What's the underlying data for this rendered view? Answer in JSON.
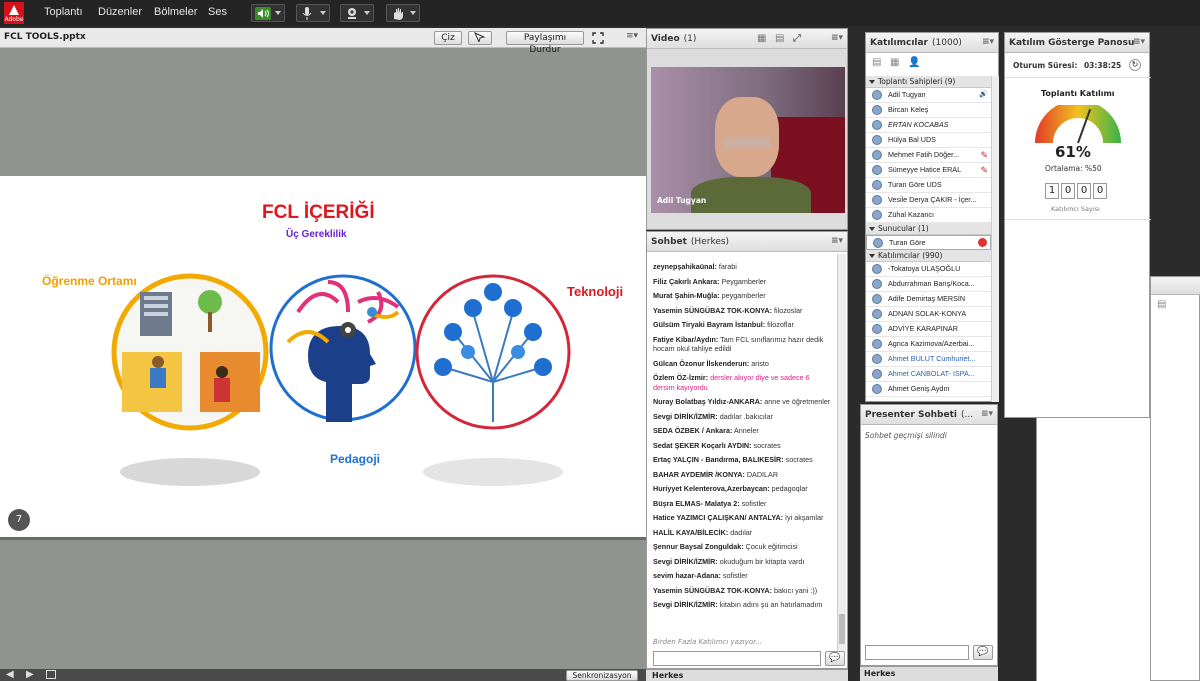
{
  "menubar": {
    "logo_text": "Adobe",
    "items": [
      "Toplantı",
      "Düzenler",
      "Bölmeler",
      "Ses"
    ]
  },
  "share": {
    "title": "FCL TOOLS.pptx",
    "draw_label": "Çiz",
    "stop_label": "Paylaşımı Durdur",
    "sync_label": "Senkronizasyon",
    "page_number": "7"
  },
  "slide": {
    "title": "FCL İÇERİĞİ",
    "subtitle": "Üç Gereklilik",
    "label_left": "Öğrenme Ortamı",
    "label_mid": "Pedagoji",
    "label_right": "Teknoloji"
  },
  "video": {
    "title": "Video",
    "count": "(1)",
    "person_name": "Adil Tugyan"
  },
  "chat": {
    "title": "Sohbet",
    "scope": "(Herkes)",
    "typing": "Birden Fazla Katılımcı yazıyor...",
    "footer": "Herkes",
    "messages": [
      {
        "name": "zeynepşahikaünal:",
        "text": " farabi"
      },
      {
        "name": "Filiz Çakırlı Ankara:",
        "text": " Peygamberler"
      },
      {
        "name": "Murat Şahin-Muğla:",
        "text": " peygamberler"
      },
      {
        "name": "Yasemin SÜNGÜBAZ TOK-KONYA:",
        "text": " filozoslar"
      },
      {
        "name": "Gülsüm Tiryaki Bayram İstanbul:",
        "text": " filozoflar"
      },
      {
        "name": "Fatiye Kibar/Aydın:",
        "text": " Tam FCL sınıflarımız hazır dedik hocam okul tahliye edildi"
      },
      {
        "name": "Gülcan Özonur İlskenderun:",
        "text": " aristo"
      },
      {
        "name": "Özlem ÖZ-İzmir:",
        "text": " dersler akıyor diye ve sadece 6 dersim kayıyordu",
        "pink": true
      },
      {
        "name": "Nuray Bolatbaş Yıldız-ANKARA:",
        "text": " anne ve öğretmenler"
      },
      {
        "name": "Sevgi DİRİK/İZMİR:",
        "text": " dadılar .bakıcılar"
      },
      {
        "name": "SEDA ÖZBEK / Ankara:",
        "text": " Anneler"
      },
      {
        "name": "Sedat ŞEKER Koçarlı AYDIN:",
        "text": " socrates"
      },
      {
        "name": "Ertaç YALÇIN - Bandırma, BALIKESİR:",
        "text": " socrates"
      },
      {
        "name": "BAHAR AYDEMİR  /KONYA:",
        "text": " DADILAR"
      },
      {
        "name": "Huriyyet Kelenterova,Azerbaycan:",
        "text": "  pedagoqlar"
      },
      {
        "name": "Büşra ELMAS- Malatya 2:",
        "text": " sofistler"
      },
      {
        "name": "Hatice YAZIMCI ÇALIŞKAN/ ANTALYA:",
        "text": " İyi akşamlar"
      },
      {
        "name": "HALİL KAYA/BİLECİK:",
        "text": " dadılar"
      },
      {
        "name": "Şennur Baysal Zonguldak:",
        "text": " Çocuk eğitimcisi"
      },
      {
        "name": "Sevgi DİRİK/İZMİR:",
        "text": " okuduğum bir kitapta vardı"
      },
      {
        "name": "sevim hazar-Adana:",
        "text": " sofistler"
      },
      {
        "name": "Yasemin SÜNGÜBAZ TOK-KONYA:",
        "text": " bakıcı yani :))"
      },
      {
        "name": "Sevgi DİRİK/İZMİR:",
        "text": " kitabın adını şu an hatırlamadım"
      }
    ]
  },
  "participants": {
    "title": "Katılımcılar",
    "count": "(1000)",
    "hosts_label": "Toplantı Sahipleri (9)",
    "hosts": [
      "Adil Tugyan",
      "Bircan Keleş",
      "ERTAN KOCABAS",
      "Hülya Bal UDS",
      "Mehmet Fatih Döğer...",
      "Sümeyye Hatice ERAL",
      "Turan Göre UDS",
      "Vesile Derya ÇAKIR - İçer...",
      "Zühal Kazancı"
    ],
    "presenters_label": "Sunucular (1)",
    "presenters": [
      "Turan Göre"
    ],
    "attendees_label": "Katılımcılar (990)",
    "attendees": [
      "-Tokatoya ULAŞOĞLU",
      "Abdurrahman Barış/Koca...",
      "Adife Demirtaş MERSİN",
      "ADNAN SOLAK-KONYA",
      "ADVİYE KARAPINAR",
      "Agnca Kazimova/Azerbai...",
      "Ahmet BULUT Cumhuriet...",
      "Ahmet CANBOLAT- ISPA...",
      "Ahmet Geniş Aydın"
    ]
  },
  "presenter_chat": {
    "title": "Presenter Sohbeti",
    "ellipsis": "(...",
    "note": "Sohbet geçmişi silindi",
    "footer": "Herkes"
  },
  "dashboard": {
    "title": "Katılım Gösterge Panosu",
    "session_label": "Oturum Süresi:",
    "session_time": "03:38:25",
    "section": "Toplantı Katılımı",
    "percent": "61%",
    "percent_value": 0.61,
    "average": "Ortalama: %50",
    "digits": [
      "1",
      "0",
      "0",
      "0"
    ],
    "count_label": "Katılımcı Sayısı"
  }
}
